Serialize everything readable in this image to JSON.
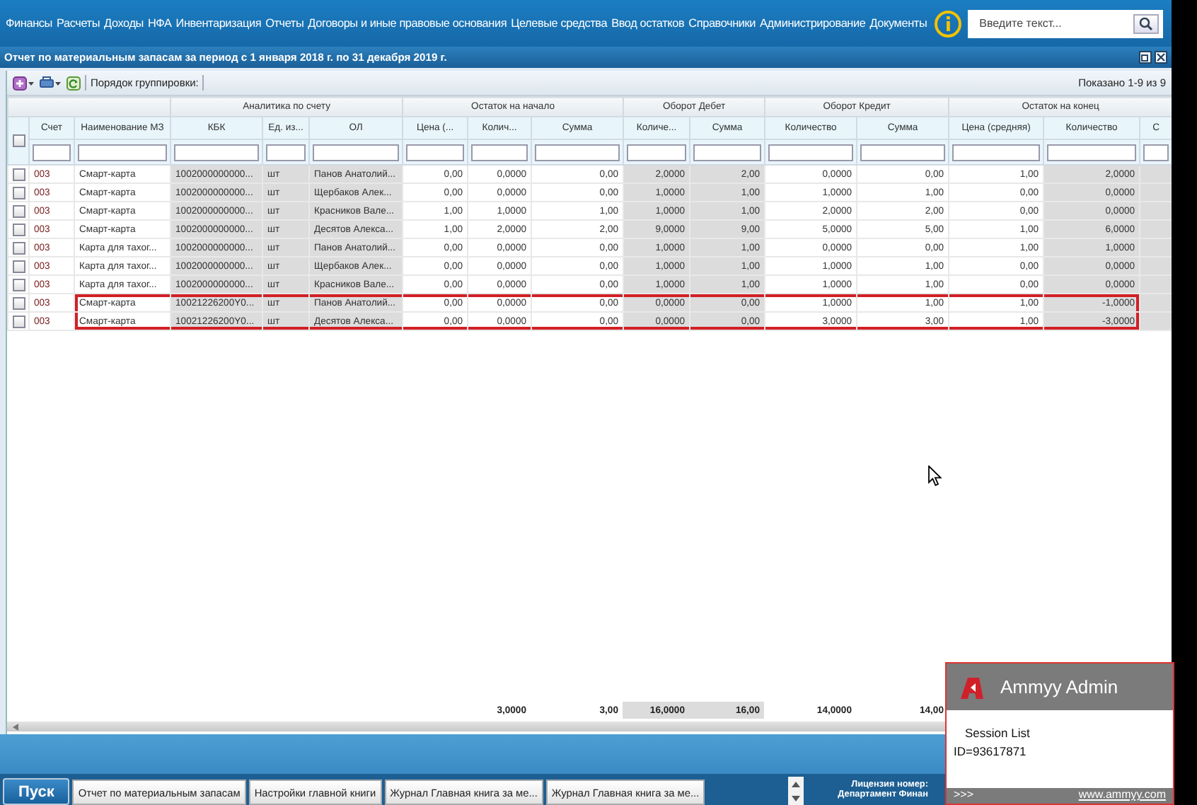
{
  "menu": [
    "Финансы",
    "Расчеты",
    "Доходы",
    "НФА",
    "Инвентаризация",
    "Отчеты",
    "Договоры и иные правовые основания",
    "Целевые средства",
    "Ввод остатков",
    "Справочники",
    "Администрирование",
    "Документы"
  ],
  "search": {
    "placeholder": "Введите текст..."
  },
  "window": {
    "title": "Отчет по материальным запасам за период с 1 января 2018 г. по 31 декабря 2019 г."
  },
  "toolbar": {
    "grouping_label": "Порядок группировки:",
    "shown": "Показано 1-9 из 9"
  },
  "table": {
    "header_checked": false,
    "groups": [
      "Аналитика по счету",
      "Остаток на начало",
      "Оборот Дебет",
      "Оборот Кредит",
      "Остаток на конец"
    ],
    "columns": [
      "Счет",
      "Наименование МЗ",
      "КБК",
      "Ед. из...",
      "ОЛ",
      "Цена (...",
      "Колич...",
      "Сумма",
      "Количе...",
      "Сумма",
      "Количество",
      "Сумма",
      "Цена (средняя)",
      "Количество",
      "С"
    ],
    "rows": [
      {
        "checked": false,
        "highlighted": false,
        "cells": [
          "003",
          "Смарт-карта",
          "1002000000000...",
          "шт",
          "Панов Анатолий...",
          "0,00",
          "0,0000",
          "0,00",
          "2,0000",
          "2,00",
          "0,0000",
          "0,00",
          "1,00",
          "2,0000"
        ]
      },
      {
        "checked": false,
        "highlighted": false,
        "cells": [
          "003",
          "Смарт-карта",
          "1002000000000...",
          "шт",
          "Щербаков Алек...",
          "0,00",
          "0,0000",
          "0,00",
          "1,0000",
          "1,00",
          "1,0000",
          "1,00",
          "0,00",
          "0,0000"
        ]
      },
      {
        "checked": false,
        "highlighted": false,
        "cells": [
          "003",
          "Смарт-карта",
          "1002000000000...",
          "шт",
          "Красников Вале...",
          "1,00",
          "1,0000",
          "1,00",
          "1,0000",
          "1,00",
          "2,0000",
          "2,00",
          "0,00",
          "0,0000"
        ]
      },
      {
        "checked": false,
        "highlighted": false,
        "cells": [
          "003",
          "Смарт-карта",
          "1002000000000...",
          "шт",
          "Десятов Алекса...",
          "1,00",
          "2,0000",
          "2,00",
          "9,0000",
          "9,00",
          "5,0000",
          "5,00",
          "1,00",
          "6,0000"
        ]
      },
      {
        "checked": false,
        "highlighted": false,
        "cells": [
          "003",
          "Карта для тахог...",
          "1002000000000...",
          "шт",
          "Панов Анатолий...",
          "0,00",
          "0,0000",
          "0,00",
          "1,0000",
          "1,00",
          "0,0000",
          "0,00",
          "1,00",
          "1,0000"
        ]
      },
      {
        "checked": false,
        "highlighted": false,
        "cells": [
          "003",
          "Карта для тахог...",
          "1002000000000...",
          "шт",
          "Щербаков Алек...",
          "0,00",
          "0,0000",
          "0,00",
          "1,0000",
          "1,00",
          "1,0000",
          "1,00",
          "0,00",
          "0,0000"
        ]
      },
      {
        "checked": false,
        "highlighted": false,
        "cells": [
          "003",
          "Карта для тахог...",
          "1002000000000...",
          "шт",
          "Красников Вале...",
          "0,00",
          "0,0000",
          "0,00",
          "1,0000",
          "1,00",
          "1,0000",
          "1,00",
          "0,00",
          "0,0000"
        ]
      },
      {
        "checked": false,
        "highlighted": true,
        "cells": [
          "003",
          "Смарт-карта",
          "10021226200Y0...",
          "шт",
          "Панов Анатолий...",
          "0,00",
          "0,0000",
          "0,00",
          "0,0000",
          "0,00",
          "1,0000",
          "1,00",
          "1,00",
          "-1,0000"
        ]
      },
      {
        "checked": false,
        "highlighted": true,
        "cells": [
          "003",
          "Смарт-карта",
          "10021226200Y0...",
          "шт",
          "Десятов Алекса...",
          "0,00",
          "0,0000",
          "0,00",
          "0,0000",
          "0,00",
          "3,0000",
          "3,00",
          "1,00",
          "-3,0000"
        ]
      }
    ],
    "totals": {
      "opening_quantity": "3,0000",
      "opening_sum": "3,00",
      "debit_quantity": "16,0000",
      "debit_sum": "16,00",
      "credit_quantity": "14,0000",
      "credit_sum": "14,00"
    }
  },
  "taskbar": {
    "start": "Пуск",
    "tasks": [
      "Отчет по материальным запасам",
      "Настройки главной книги",
      "Журнал Главная книга за ме...",
      "Журнал Главная книга за ме..."
    ],
    "license": "Лицензия номер:",
    "department": "Департамент Финан"
  },
  "popup": {
    "title": "Ammyy Admin",
    "link": "Session List",
    "id": "ID=93617871",
    "footer_left": ">>>",
    "footer_right": "www.ammyy.com"
  }
}
